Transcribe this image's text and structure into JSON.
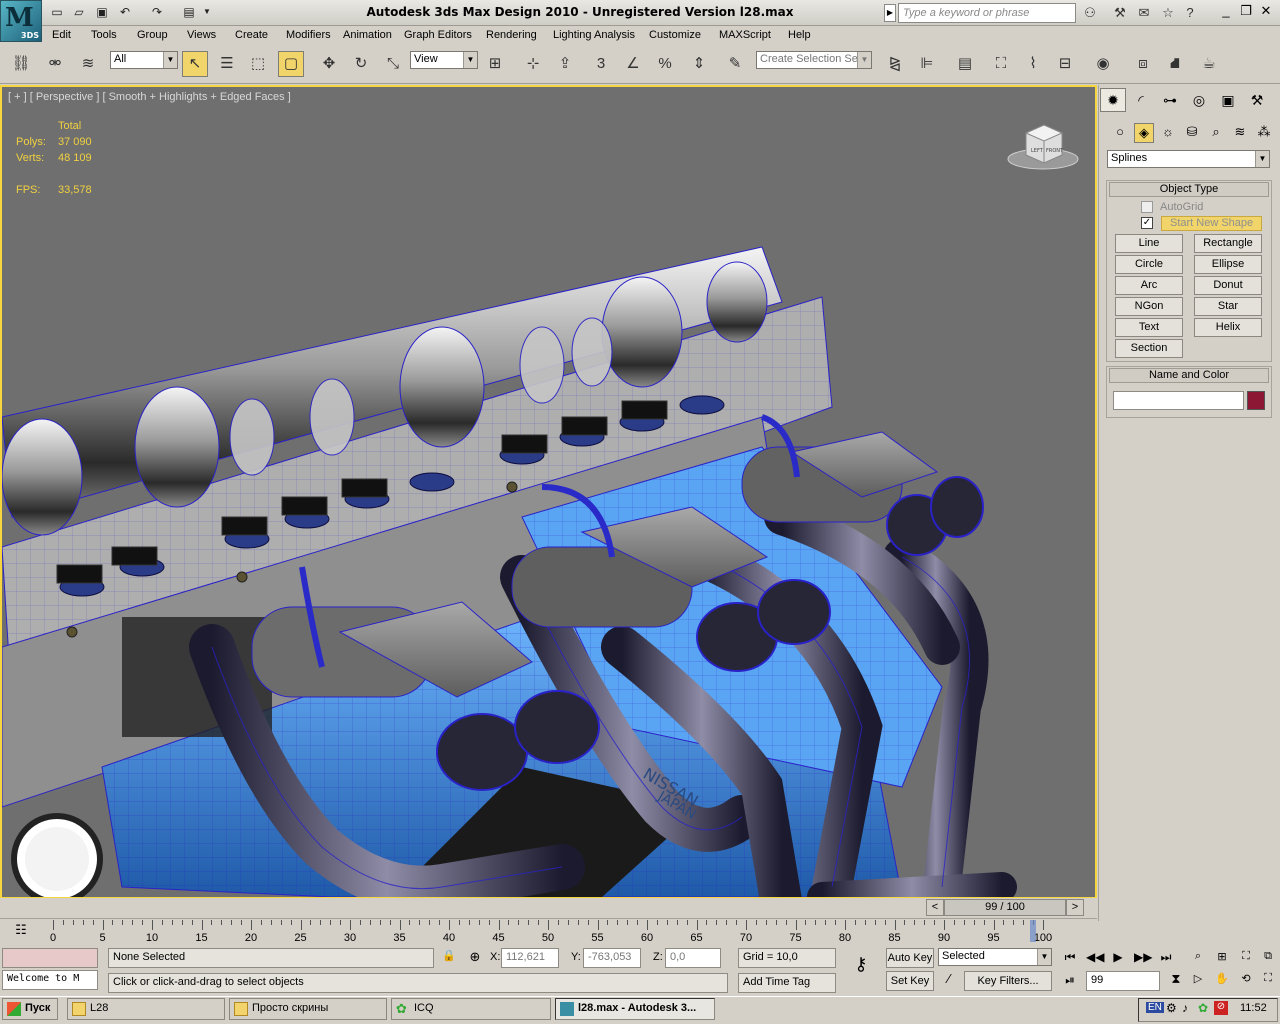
{
  "window": {
    "title": "Autodesk 3ds Max Design 2010   -  Unregistered Version      l28.max",
    "logo_letter": "M",
    "logo_sub": "3DS",
    "search_placeholder": "Type a keyword or phrase"
  },
  "menu": [
    "Edit",
    "Tools",
    "Group",
    "Views",
    "Create",
    "Modifiers",
    "Animation",
    "Graph Editors",
    "Rendering",
    "Lighting Analysis",
    "Customize",
    "MAXScript",
    "Help"
  ],
  "toolbar": {
    "selection_filter": "All",
    "ref_coord": "View",
    "named_selection_placeholder": "Create Selection Se",
    "snap_label": "3",
    "percent_label": "%"
  },
  "viewport": {
    "label": "[ + ] [ Perspective ] [ Smooth + Highlights + Edged Faces ]",
    "stats": {
      "header": "Total",
      "polys_label": "Polys:",
      "polys": "37 090",
      "verts_label": "Verts:",
      "verts": "48 109",
      "fps_label": "FPS:",
      "fps": "33,578"
    },
    "viewcube": {
      "left": "LEFT",
      "front": "FRONT"
    },
    "brand_text": "NISSAN",
    "brand_text2": "JAPAN"
  },
  "command_panel": {
    "category": "Splines",
    "object_type_title": "Object Type",
    "autogrid": "AutoGrid",
    "start_new_shape": "Start New Shape",
    "start_new_shape_checked": true,
    "buttons": [
      [
        "Line",
        "Rectangle"
      ],
      [
        "Circle",
        "Ellipse"
      ],
      [
        "Arc",
        "Donut"
      ],
      [
        "NGon",
        "Star"
      ],
      [
        "Text",
        "Helix"
      ],
      [
        "Section",
        ""
      ]
    ],
    "name_color_title": "Name and Color",
    "object_name": "",
    "object_color": "#8c1734"
  },
  "timeline": {
    "frame": "99 / 100",
    "prev": "<",
    "next": ">",
    "current_frame": 99,
    "ticks": [
      0,
      5,
      10,
      15,
      20,
      25,
      30,
      35,
      40,
      45,
      50,
      55,
      60,
      65,
      70,
      75,
      80,
      85,
      90,
      95,
      100
    ]
  },
  "status": {
    "script_listener": "Welcome to M",
    "selection": "None Selected",
    "prompt": "Click or click-and-drag to select objects",
    "x_label": "X:",
    "x": "112,621",
    "y_label": "Y:",
    "y": "-763,053",
    "z_label": "Z:",
    "z": "0,0",
    "grid": "Grid = 10,0",
    "add_time_tag": "Add Time Tag",
    "auto_key": "Auto Key",
    "set_key": "Set Key",
    "key_mode": "Selected",
    "key_filters": "Key Filters...",
    "frame_field": "99"
  },
  "taskbar": {
    "start": "Пуск",
    "tasks": [
      "L28",
      "Просто скрины",
      "ICQ",
      "l28.max - Autodesk 3..."
    ],
    "lang": "EN",
    "clock": "11:52"
  }
}
